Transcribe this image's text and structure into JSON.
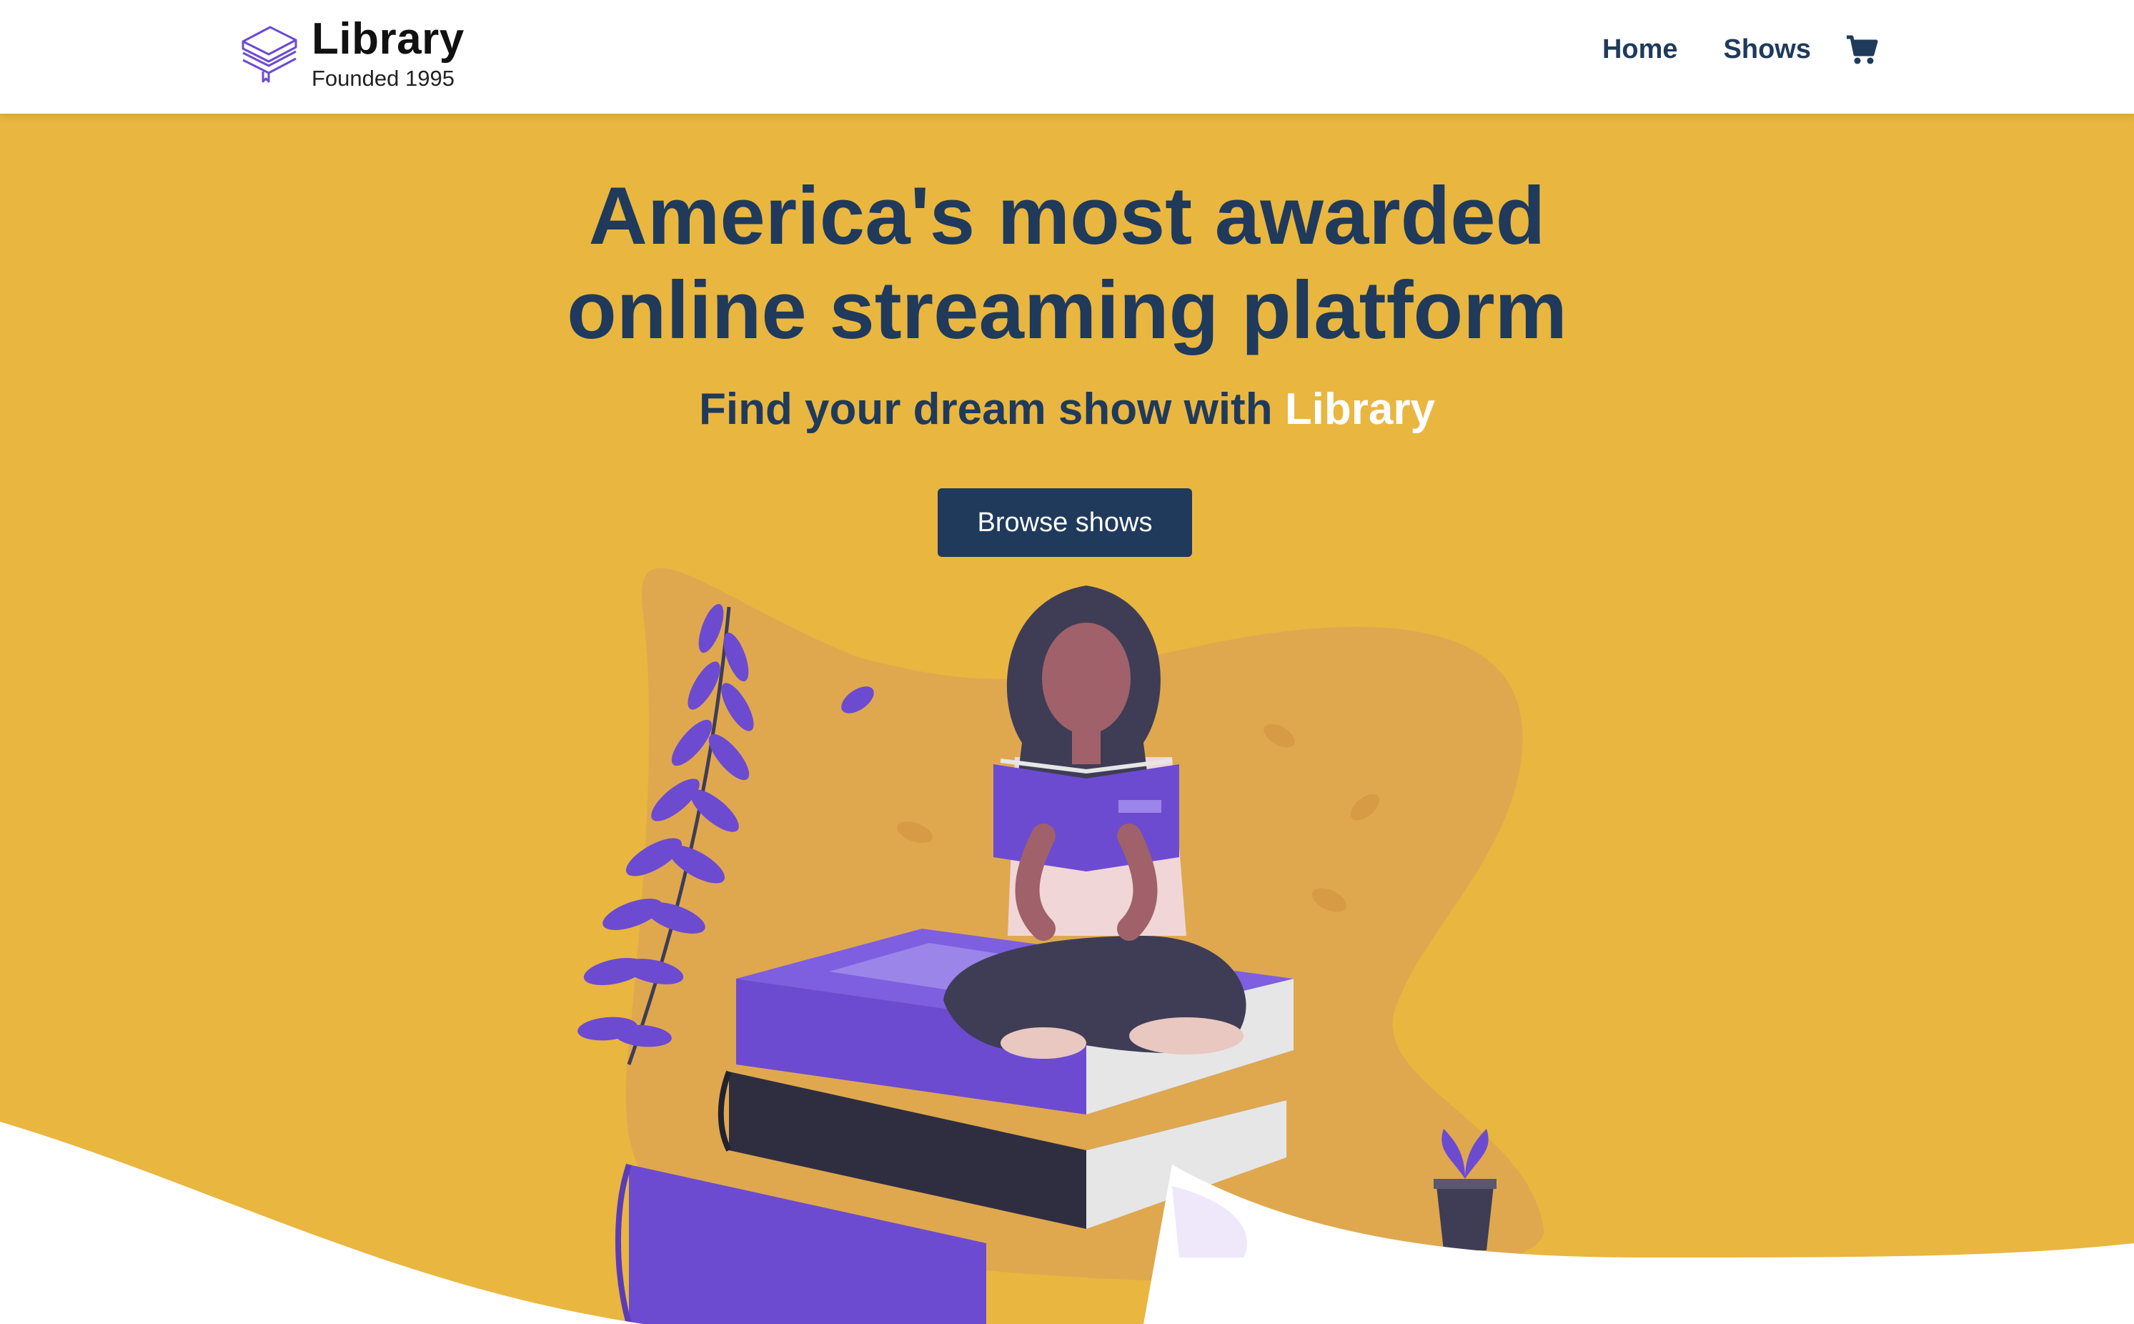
{
  "brand": {
    "title": "Library",
    "subtitle": "Founded 1995",
    "icon": "stacked-books-icon"
  },
  "nav": {
    "links": [
      "Home",
      "Shows"
    ],
    "cart_icon": "shopping-cart-icon"
  },
  "hero": {
    "title_line1": "America's most awarded",
    "title_line2": "online streaming platform",
    "subtitle_prefix": "Find your dream show with ",
    "subtitle_accent": "Library",
    "cta_label": "Browse shows",
    "illustration": "woman-reading-on-books-illustration"
  },
  "colors": {
    "primary": "#1f3a5b",
    "hero_background": "#e9b640",
    "accent_purple": "#6c4bd1",
    "white": "#ffffff"
  }
}
